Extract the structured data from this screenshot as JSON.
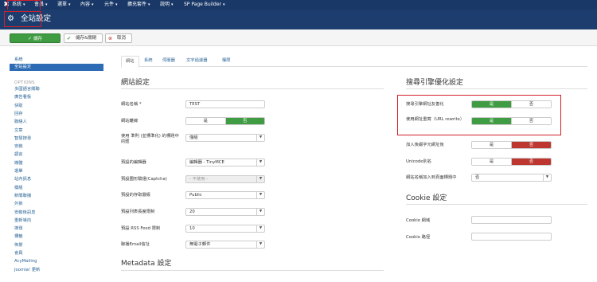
{
  "topnav": {
    "items": [
      {
        "label": "系統"
      },
      {
        "label": "會員"
      },
      {
        "label": "選單"
      },
      {
        "label": "內容"
      },
      {
        "label": "元件"
      },
      {
        "label": "擴充套件"
      },
      {
        "label": "說明"
      },
      {
        "label": "SP Page Builder"
      }
    ]
  },
  "header": {
    "title": "全站設定"
  },
  "toolbar": {
    "save": "儲存",
    "save_close": "儲存&關閉",
    "cancel": "取消"
  },
  "sidebar": {
    "system_label": "系統",
    "active_label": "全站設定",
    "options_heading": "OPTIONS",
    "items": [
      "多國語言關聯",
      "廣告看板",
      "快取",
      "回存",
      "聯絡人",
      "文章",
      "智慧搜尋",
      "安裝",
      "語言",
      "媒體",
      "選單",
      "站內訊息",
      "模組",
      "新聞聯播",
      "外掛",
      "安裝後訊息",
      "重新導向",
      "搜尋",
      "標籤",
      "佈景",
      "會員",
      "AcyMailing",
      "Joomla! 更新"
    ]
  },
  "tabs": [
    "網站",
    "系統",
    "伺服器",
    "文字過濾器",
    "權限"
  ],
  "left": {
    "section_title": "網站設定",
    "rows": {
      "site_name": {
        "label": "網站名稱 *",
        "value": "TEST"
      },
      "offline": {
        "label": "網站離線",
        "yes": "是",
        "no": "否"
      },
      "unicode_aliases": {
        "label": "使用 準則 (並標準化) 的標題中的匯",
        "value": "僅組"
      },
      "editor": {
        "label": "預設的編輯器",
        "value": "編輯器 - TinyMCE"
      },
      "captcha": {
        "label": "預設圖形驗證(Captcha)",
        "value": "- 不使用 -"
      },
      "access": {
        "label": "預設的存取層級",
        "value": "Public"
      },
      "list_limit": {
        "label": "預設列表長度限制",
        "value": "20"
      },
      "feed_limit": {
        "label": "預設 RSS Feed 限制",
        "value": "10"
      },
      "feed_email": {
        "label": "聯播Email信址",
        "value": "無電子郵件"
      }
    },
    "metadata_title": "Metadata 設定"
  },
  "right": {
    "seo_title": "搜尋引擎優化設定",
    "rows": {
      "sef": {
        "label": "搜尋引擎網址友善化",
        "yes": "是",
        "no": "否"
      },
      "rewrite": {
        "label": "使用網址重寫（URL rewrite）",
        "yes": "是",
        "no": "否"
      },
      "suffix": {
        "label": "加入後綴字元網址後",
        "yes": "是",
        "no": "否"
      },
      "unicode": {
        "label": "Unicode別名",
        "yes": "是",
        "no": "否"
      },
      "sitename_pagetitle": {
        "label": "網站名稱加入到頁面標題中",
        "value": "否"
      }
    },
    "cookie_title": "Cookie 設定",
    "cookie_rows": {
      "domain": {
        "label": "Cookie 網域",
        "value": ""
      },
      "path": {
        "label": "Cookie 路徑",
        "value": ""
      }
    }
  },
  "colors": {
    "navy": "#1a3867",
    "header": "#1c3d6e",
    "green": "#3f9c43",
    "red": "#bd362f",
    "highlight": "#d3202b",
    "active": "#2d6cb4"
  }
}
